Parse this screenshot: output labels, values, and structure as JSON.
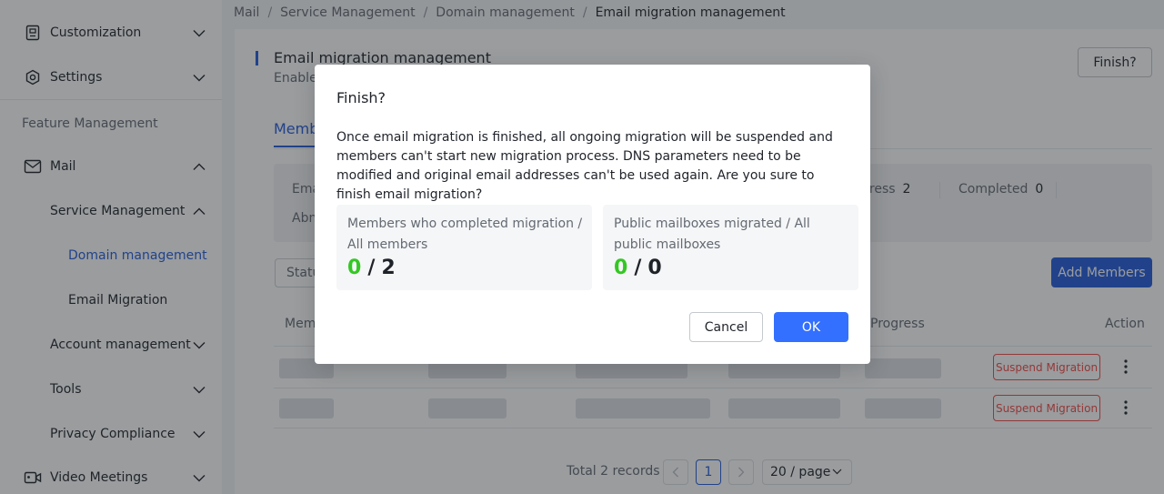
{
  "breadcrumb": [
    "Mail",
    "Service Management",
    "Domain management",
    "Email migration management"
  ],
  "sidebar": {
    "items": [
      {
        "label": "Customization"
      },
      {
        "label": "Settings"
      },
      {
        "group_label": "Feature Management"
      },
      {
        "label": "Mail"
      },
      {
        "label": "Service Management"
      },
      {
        "label": "Domain management"
      },
      {
        "label": "Email Migration"
      },
      {
        "label": "Account management"
      },
      {
        "label": "Tools"
      },
      {
        "label": "Privacy Compliance"
      },
      {
        "label": "Video Meetings"
      }
    ]
  },
  "main": {
    "title": "Email migration management",
    "subtitle": "Enable",
    "finish_label": "Finish?",
    "tab_label": "Memb",
    "stats": {
      "row1": "Ema",
      "row2": "Abn",
      "in_progress_label": "gress",
      "in_progress_value": "2",
      "completed_label": "Completed",
      "completed_value": "0"
    },
    "status_label": "Statu",
    "add_members_label": "Add Members",
    "table": {
      "headers": [
        "Memb",
        "Progress",
        "Action"
      ],
      "rows": [
        {
          "action": "Suspend Migration"
        },
        {
          "action": "Suspend Migration"
        }
      ]
    },
    "pagination": {
      "total": "Total 2 records",
      "current_page": "1",
      "page_size": "20 / page"
    }
  },
  "dialog": {
    "title": "Finish?",
    "message": "Once email migration is finished, all ongoing migration will be suspended and members can't start new migration process. DNS parameters need to be modified and original email addresses can't be used again. Are you sure to finish email migration?",
    "members_caption": "Members who completed migration / All members",
    "members_done": "0",
    "members_total": "2",
    "mailboxes_caption": "Public mailboxes migrated / All public mailboxes",
    "mailboxes_done": "0",
    "mailboxes_total": "0",
    "cancel_label": "Cancel",
    "ok_label": "OK"
  },
  "colors": {
    "accent": "#245bdb",
    "primary_button": "#3370ff",
    "danger": "#f54a45",
    "success": "#34c724"
  }
}
